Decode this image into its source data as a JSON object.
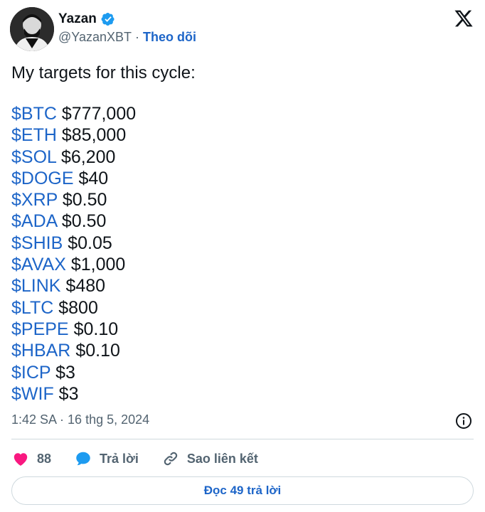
{
  "author": {
    "name": "Yazan",
    "handle": "@YazanXBT",
    "separator": "·",
    "follow_label": "Theo dõi",
    "verified": true
  },
  "icons": {
    "brand": "x-logo-icon",
    "verified": "verified-badge-icon",
    "info": "info-icon",
    "like": "heart-icon",
    "reply": "speech-bubble-icon",
    "link": "link-icon"
  },
  "tweet": {
    "intro": "My targets for this cycle:",
    "targets": [
      {
        "ticker": "$BTC",
        "price": "$777,000"
      },
      {
        "ticker": "$ETH",
        "price": "$85,000"
      },
      {
        "ticker": "$SOL",
        "price": "$6,200"
      },
      {
        "ticker": "$DOGE",
        "price": "$40"
      },
      {
        "ticker": "$XRP",
        "price": "$0.50"
      },
      {
        "ticker": "$ADA",
        "price": "$0.50"
      },
      {
        "ticker": "$SHIB",
        "price": "$0.05"
      },
      {
        "ticker": "$AVAX",
        "price": "$1,000"
      },
      {
        "ticker": "$LINK",
        "price": "$480"
      },
      {
        "ticker": "$LTC",
        "price": "$800"
      },
      {
        "ticker": "$PEPE",
        "price": "$0.10"
      },
      {
        "ticker": "$HBAR",
        "price": "$0.10"
      },
      {
        "ticker": "$ICP",
        "price": "$3"
      },
      {
        "ticker": "$WIF",
        "price": "$3"
      }
    ],
    "timestamp": "1:42 SA · 16 thg 5, 2024"
  },
  "actions": {
    "like_count": "88",
    "reply_label": "Trả lời",
    "copy_link_label": "Sao liên kết"
  },
  "read_replies_label": "Đọc 49 trả lời",
  "colors": {
    "link_blue": "#1d65c8",
    "text": "#0f1419",
    "muted": "#536471",
    "like_pink": "#f91880",
    "reply_blue": "#1d9bf0",
    "border": "#cfd9de"
  }
}
